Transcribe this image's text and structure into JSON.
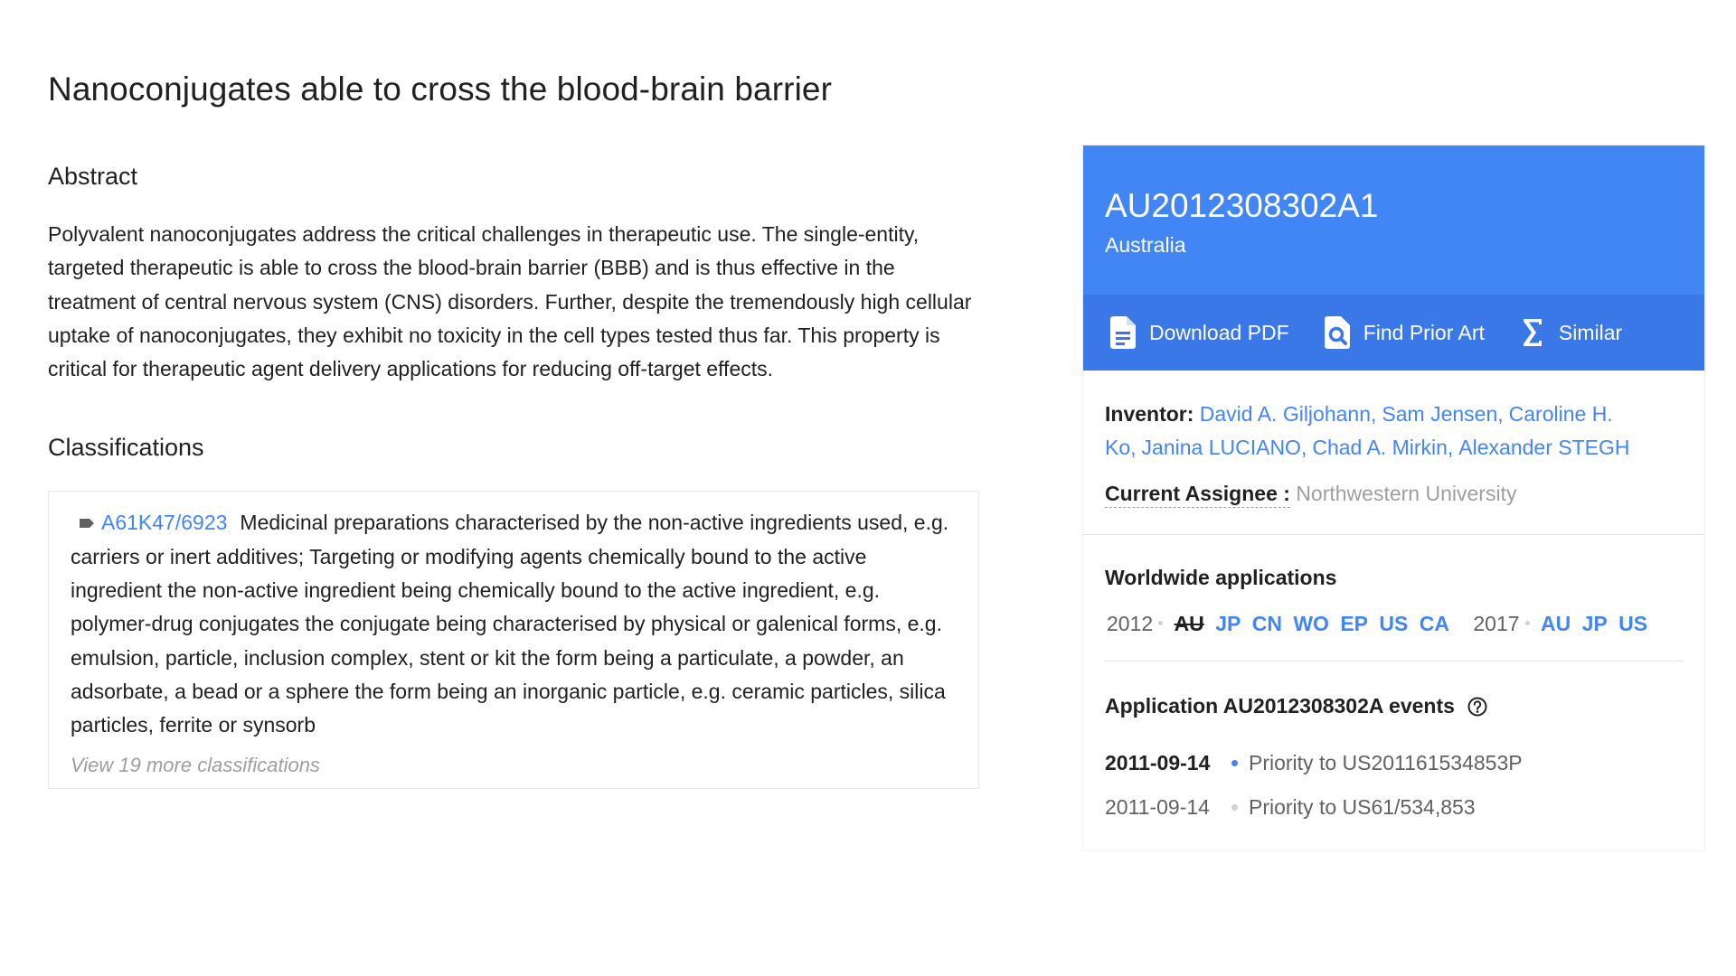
{
  "title": "Nanoconjugates able to cross the blood-brain barrier",
  "abstract": {
    "heading": "Abstract",
    "text": "Polyvalent nanoconjugates address the critical challenges in therapeutic use. The single-entity, targeted therapeutic is able to cross the blood-brain barrier (BBB) and is thus effective in the treatment of central nervous system (CNS) disorders. Further, despite the tremendously high cellular uptake of nanoconjugates, they exhibit no toxicity in the cell types tested thus far. This property is critical for therapeutic agent delivery applications for reducing off-target effects."
  },
  "classifications": {
    "heading": "Classifications",
    "code": "A61K47/6923",
    "code_icon": "tag-icon",
    "description": "Medicinal preparations characterised by the non-active ingredients used, e.g. carriers or inert additives; Targeting or modifying agents chemically bound to the active ingredient the non-active ingredient being chemically bound to the active ingredient, e.g. polymer-drug conjugates the conjugate being characterised by physical or galenical forms, e.g. emulsion, particle, inclusion complex, stent or kit the form being a particulate, a powder, an adsorbate, a bead or a sphere the form being an inorganic particle, e.g. ceramic particles, silica particles, ferrite or synsorb",
    "view_more": "View 19 more classifications"
  },
  "card": {
    "pub_number": "AU2012308302A1",
    "country": "Australia",
    "actions": [
      {
        "label": "Download PDF",
        "icon": "pdf-file-icon"
      },
      {
        "label": "Find Prior Art",
        "icon": "search-document-icon"
      },
      {
        "label": "Similar",
        "icon": "sigma-icon"
      }
    ],
    "inventor_label": "Inventor:",
    "inventors": [
      "David A. Giljohann",
      "Sam Jensen",
      "Caroline H. Ko",
      "Janina LUCIANO",
      "Chad A. Mirkin",
      "Alexander STEGH"
    ],
    "assignee_label": "Current Assignee :",
    "assignee": "Northwestern University",
    "worldwide": {
      "heading": "Worldwide applications",
      "groups": [
        {
          "year": "2012",
          "countries": [
            {
              "code": "AU",
              "current": true
            },
            {
              "code": "JP",
              "current": false
            },
            {
              "code": "CN",
              "current": false
            },
            {
              "code": "WO",
              "current": false
            },
            {
              "code": "EP",
              "current": false
            },
            {
              "code": "US",
              "current": false
            },
            {
              "code": "CA",
              "current": false
            }
          ]
        },
        {
          "year": "2017",
          "countries": [
            {
              "code": "AU",
              "current": false
            },
            {
              "code": "JP",
              "current": false
            },
            {
              "code": "US",
              "current": false
            }
          ]
        }
      ]
    },
    "events": {
      "heading": "Application AU2012308302A events",
      "help_icon": "help-circle-icon",
      "items": [
        {
          "date": "2011-09-14",
          "text": "Priority to US201161534853P",
          "active": true
        },
        {
          "date": "2011-09-14",
          "text": "Priority to US61/534,853",
          "active": false
        }
      ]
    }
  },
  "colors": {
    "accent": "#4285f4",
    "action_bar": "#3b78e7",
    "muted": "#9e9e9e"
  }
}
